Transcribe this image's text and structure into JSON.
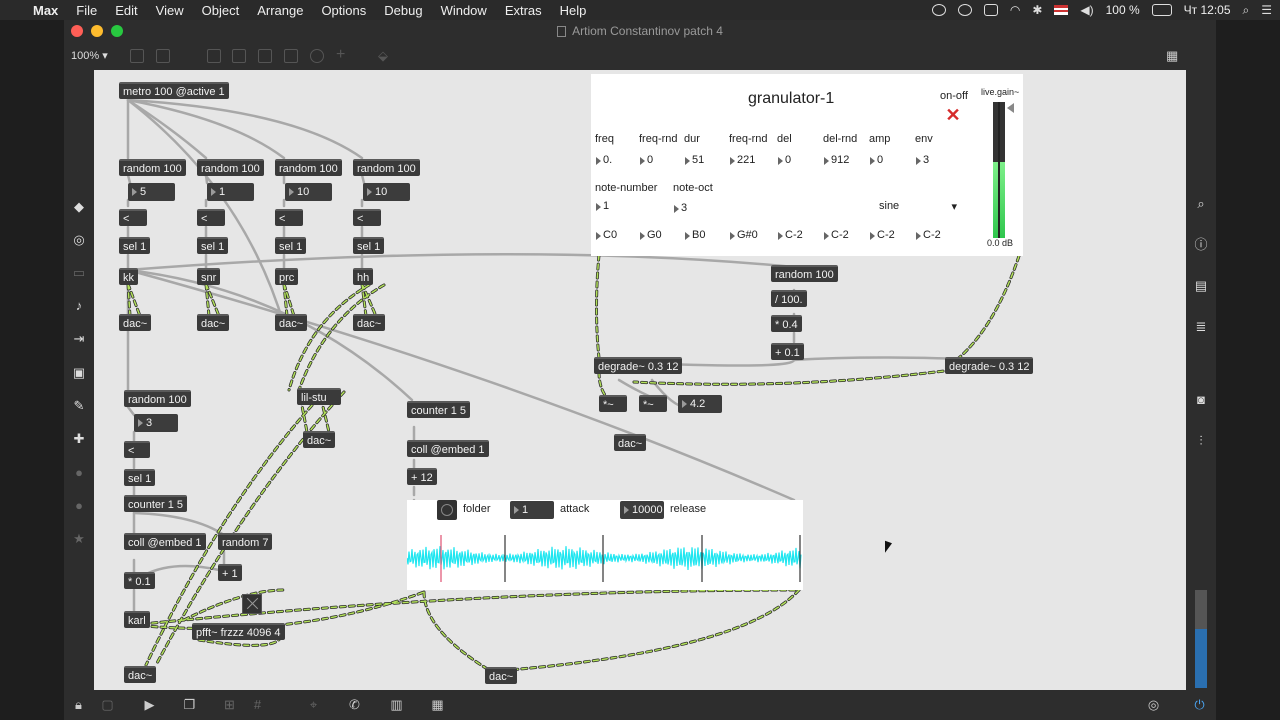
{
  "menubar": {
    "app": "Max",
    "items": [
      "File",
      "Edit",
      "View",
      "Object",
      "Arrange",
      "Options",
      "Debug",
      "Window",
      "Extras",
      "Help"
    ],
    "battery": "100 %",
    "clock": "Чт 12:05"
  },
  "window": {
    "title": "Artiom Constantinov patch 4",
    "zoom": "100% ▾"
  },
  "patch": {
    "objects": {
      "metro": "metro 100 @active 1",
      "r1": "random 100",
      "r2": "random 100",
      "r3": "random 100",
      "r4": "random 100",
      "lt1": "<",
      "lt2": "<",
      "lt3": "<",
      "lt4": "<",
      "s1": "sel 1",
      "s2": "sel 1",
      "s3": "sel 1",
      "s4": "sel 1",
      "kk": "kk",
      "snr": "snr",
      "prc": "prc",
      "hh": "hh",
      "d1": "dac~",
      "d2": "dac~",
      "d3": "dac~",
      "d4": "dac~",
      "lil": "lil-stu",
      "dlil": "dac~",
      "rand_b": "random 100",
      "lt_b": "<",
      "sel_b": "sel 1",
      "counter_b": "counter 1 5",
      "coll_b": "coll @embed 1",
      "random7": "random 7",
      "mul01": "* 0.1",
      "plus1": "+ 1",
      "karl": "karl",
      "pfft": "pfft~ frzzz 4096 4",
      "dac_bl": "dac~",
      "counter_m": "counter 1 5",
      "coll_m": "coll @embed 1",
      "plus12": "+ 12",
      "dac_bm": "dac~",
      "rand_r": "random 100",
      "div100": "/ 100.",
      "mul04": "* 0.4",
      "plus01": "+ 0.1",
      "deg1": "degrade~ 0.3 12",
      "deg2": "degrade~ 0.3 12",
      "mult1": "*~",
      "mult2": "*~",
      "dac_r": "dac~"
    },
    "numbers": {
      "n1": "5",
      "n2": "1",
      "n3": "10",
      "n4": "10",
      "n_b": "3",
      "n_r": "4.2"
    }
  },
  "granulator": {
    "title": "granulator-1",
    "onoff_label": "on-off",
    "gain_label": "live.gain~",
    "gain_value": "0.0 dB",
    "params": [
      {
        "label": "freq",
        "value": "0."
      },
      {
        "label": "freq-rnd",
        "value": "0"
      },
      {
        "label": "dur",
        "value": "51"
      },
      {
        "label": "freq-rnd",
        "value": "221"
      },
      {
        "label": "del",
        "value": "0"
      },
      {
        "label": "del-rnd",
        "value": "912"
      },
      {
        "label": "amp",
        "value": "0"
      },
      {
        "label": "env",
        "value": "3"
      }
    ],
    "note_number_label": "note-number",
    "note_number": "1",
    "note_oct_label": "note-oct",
    "note_oct": "3",
    "wave_select": "sine",
    "notes": [
      "C0",
      "G0",
      "B0",
      "G#0",
      "C-2",
      "C-2",
      "C-2",
      "C-2"
    ]
  },
  "sampler": {
    "folder_label": "folder",
    "attack_value": "1",
    "attack_label": "attack",
    "release_value": "10000",
    "release_label": "release"
  },
  "colors": {
    "canvas": "#e6e6e6",
    "object": "#3a3a3a",
    "waveform": "#1ee6f0",
    "signal_cord": "#9adc4a",
    "meter": "#3ed05a"
  }
}
